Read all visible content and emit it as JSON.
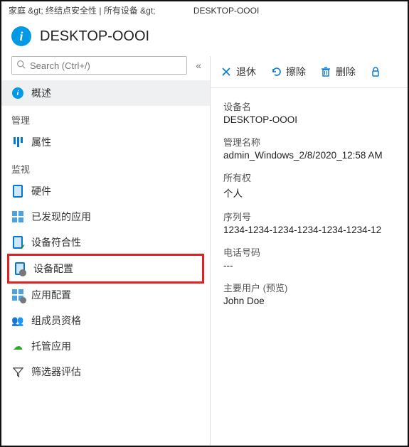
{
  "breadcrumb": {
    "path": "家庭 &gt;  终结点安全性 | 所有设备 &gt;",
    "tab": "DESKTOP-OOOI"
  },
  "header": {
    "title": "DESKTOP-OOOI"
  },
  "sidebar": {
    "search_placeholder": "Search (Ctrl+/)",
    "collapse_glyph": "«",
    "items": {
      "overview": "概述",
      "section_manage": "管理",
      "properties": "属性",
      "section_monitor": "监视",
      "hardware": "硬件",
      "discovered_apps": "已发现的应用",
      "device_compliance": "设备符合性",
      "device_config": "设备配置",
      "app_config": "应用配置",
      "group_membership": "组成员资格",
      "managed_apps": "托管应用",
      "filter_eval": "筛选器评估"
    }
  },
  "toolbar": {
    "retire": "退休",
    "wipe": "擦除",
    "delete": "删除"
  },
  "details": {
    "device_name_label": "设备名",
    "device_name_value": "DESKTOP-OOOI",
    "mgmt_name_label": "管理名称",
    "mgmt_name_value": "admin_Windows_2/8/2020_12:58 AM",
    "ownership_label": "所有权",
    "ownership_value": "个人",
    "serial_label": "序列号",
    "serial_value": "1234-1234-1234-1234-1234-1234-12",
    "phone_label": "电话号码",
    "phone_value": "---",
    "primary_user_label": "主要用户 (预览)",
    "primary_user_value": "John Doe"
  }
}
